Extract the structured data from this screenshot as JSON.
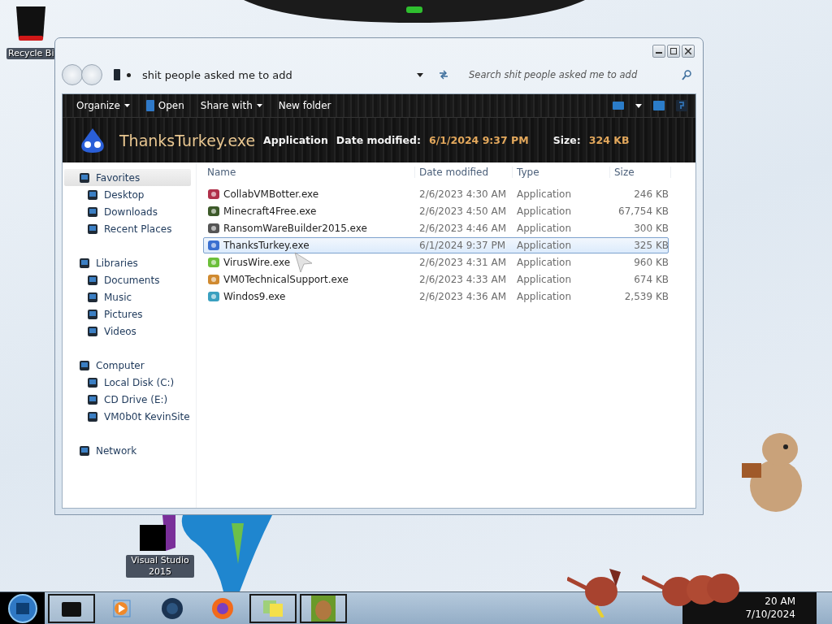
{
  "desktop": {
    "icons": [
      {
        "label": "Recycle Bi"
      },
      {
        "label": "Visual Studio 2015"
      }
    ]
  },
  "window": {
    "address": {
      "path": "shit people asked me to add"
    },
    "search": {
      "placeholder": "Search shit people asked me to add"
    },
    "toolbar": [
      {
        "label": "Organize",
        "dropdown": true
      },
      {
        "label": "Open",
        "dropdown": false
      },
      {
        "label": "Share with",
        "dropdown": true
      },
      {
        "label": "New folder",
        "dropdown": false
      }
    ],
    "details": {
      "name": "ThanksTurkey.exe",
      "type": "Application",
      "date_label": "Date modified:",
      "date": "6/1/2024 9:37 PM",
      "size_label": "Size:",
      "size": "324 KB"
    },
    "nav": [
      {
        "label": "Favorites",
        "selected": true,
        "children": [
          {
            "label": "Desktop",
            "selected": false
          },
          {
            "label": "Downloads",
            "selected": false
          },
          {
            "label": "Recent Places",
            "selected": false
          }
        ]
      },
      {
        "label": "Libraries",
        "selected": false,
        "children": [
          {
            "label": "Documents",
            "selected": false
          },
          {
            "label": "Music",
            "selected": false
          },
          {
            "label": "Pictures",
            "selected": false
          },
          {
            "label": "Videos",
            "selected": false
          }
        ]
      },
      {
        "label": "Computer",
        "selected": false,
        "children": [
          {
            "label": "Local Disk (C:)",
            "selected": false
          },
          {
            "label": "CD Drive (E:)",
            "selected": false
          },
          {
            "label": "VM0b0t KevinSite",
            "selected": false
          }
        ]
      },
      {
        "label": "Network",
        "selected": false
      }
    ],
    "columns": [
      "Name",
      "Date modified",
      "Type",
      "Size"
    ],
    "rows": [
      {
        "name": "CollabVMBotter.exe",
        "date": "2/6/2023 4:30 AM",
        "type": "Application",
        "size": "246 KB",
        "selected": false
      },
      {
        "name": "Minecraft4Free.exe",
        "date": "2/6/2023 4:50 AM",
        "type": "Application",
        "size": "67,754 KB",
        "selected": false
      },
      {
        "name": "RansomWareBuilder2015.exe",
        "date": "2/6/2023 4:46 AM",
        "type": "Application",
        "size": "300 KB",
        "selected": false
      },
      {
        "name": "ThanksTurkey.exe",
        "date": "6/1/2024 9:37 PM",
        "type": "Application",
        "size": "325 KB",
        "selected": true
      },
      {
        "name": "VirusWire.exe",
        "date": "2/6/2023 4:31 AM",
        "type": "Application",
        "size": "960 KB",
        "selected": false
      },
      {
        "name": "VM0TechnicalSupport.exe",
        "date": "2/6/2023 4:33 AM",
        "type": "Application",
        "size": "674 KB",
        "selected": false
      },
      {
        "name": "Windos9.exe",
        "date": "2/6/2023 4:36 AM",
        "type": "Application",
        "size": "2,539 KB",
        "selected": false
      }
    ]
  },
  "taskbar": {
    "clock": {
      "time": "20 AM",
      "date": "7/10/2024"
    }
  }
}
